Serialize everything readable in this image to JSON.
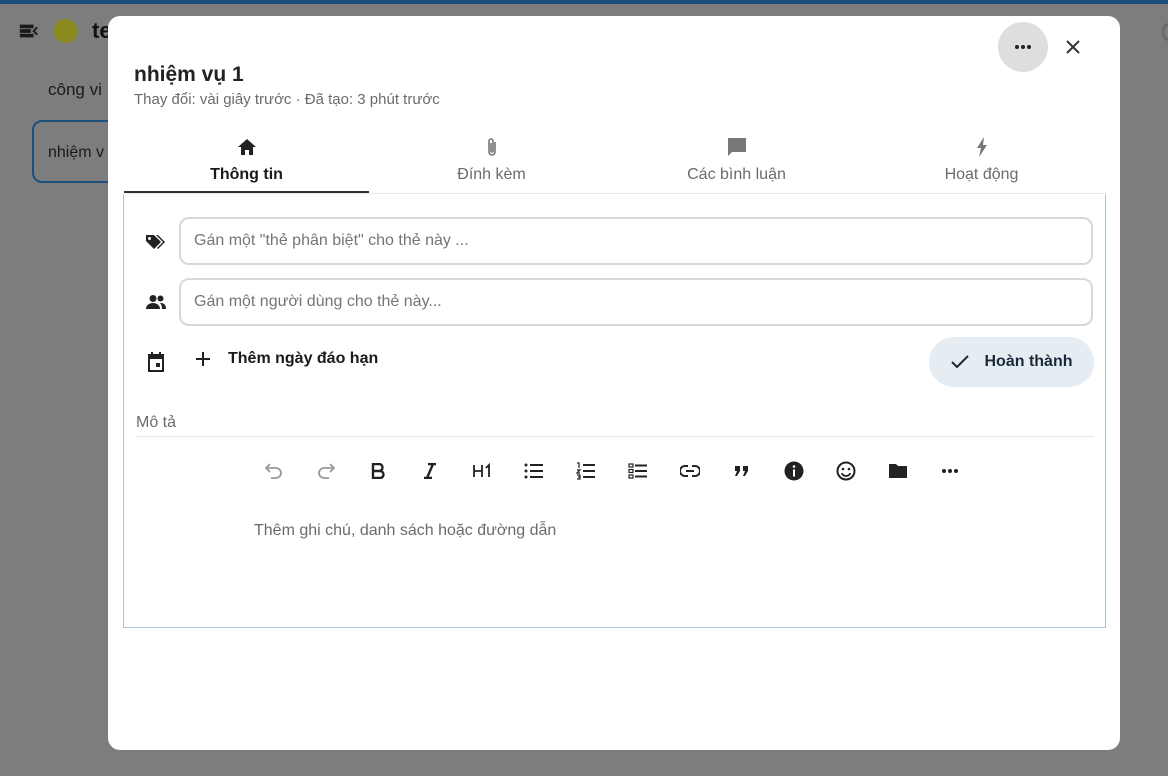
{
  "background": {
    "board_title": "te",
    "stack_title": "công vi",
    "card_title": "nhiệm v"
  },
  "modal": {
    "title": "nhiệm vụ 1",
    "subtitle": "Thay đổi: vài giây trước · Đã tạo: 3 phút trước",
    "tabs": [
      {
        "label": "Thông tin",
        "icon": "home-icon",
        "active": true
      },
      {
        "label": "Đính kèm",
        "icon": "paperclip-icon",
        "active": false
      },
      {
        "label": "Các bình luận",
        "icon": "comment-icon",
        "active": false
      },
      {
        "label": "Hoạt động",
        "icon": "lightning-icon",
        "active": false
      }
    ],
    "tags_placeholder": "Gán một \"thẻ phân biệt\" cho thẻ này ...",
    "assign_placeholder": "Gán một người dùng cho thẻ này...",
    "add_due_date_label": "Thêm ngày đáo hạn",
    "complete_label": "Hoàn thành",
    "description_label": "Mô tả",
    "editor_toolbar": [
      "undo",
      "redo",
      "bold",
      "italic",
      "heading-1",
      "bullet-list",
      "numbered-list",
      "task-list",
      "link",
      "blockquote",
      "callout-info",
      "emoji",
      "insert-file",
      "more"
    ],
    "editor_placeholder": "Thêm ghi chú, danh sách hoặc đường dẫn"
  },
  "colors": {
    "accent": "#1c4f7a",
    "complete_button_bg": "#e5edf3",
    "overlay": "#7d7d7d"
  }
}
